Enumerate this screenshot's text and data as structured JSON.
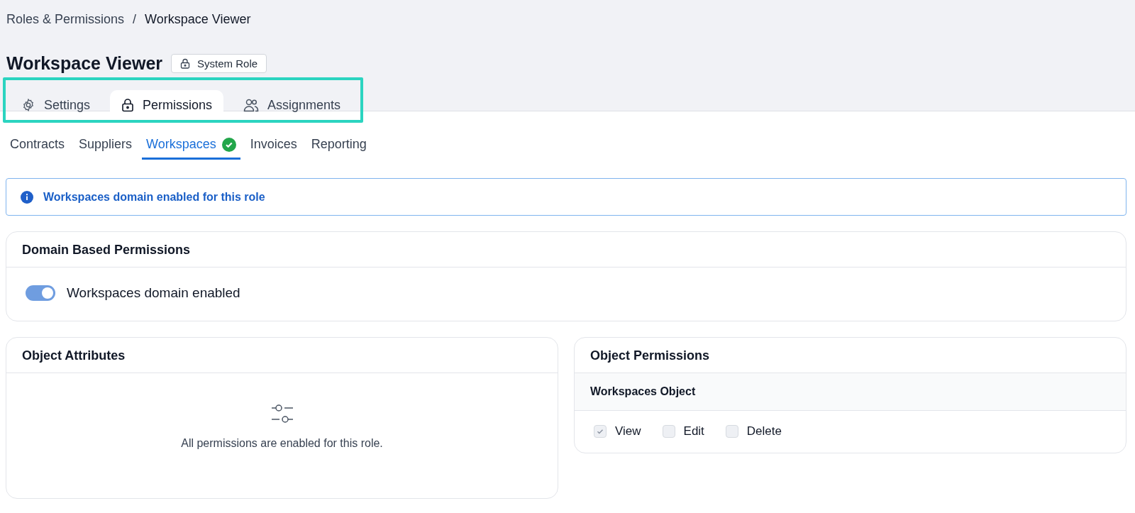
{
  "breadcrumb": [
    {
      "label": "Roles & Permissions",
      "current": false
    },
    {
      "label": "/",
      "current": false
    },
    {
      "label": "Workspace Viewer",
      "current": true
    }
  ],
  "page": {
    "title": "Workspace Viewer",
    "badge": "System Role"
  },
  "tabs": [
    {
      "label": "Settings",
      "kind": "settings",
      "selected": false
    },
    {
      "label": "Permissions",
      "kind": "permissions",
      "selected": true
    },
    {
      "label": "Assignments",
      "kind": "assignments",
      "selected": false
    }
  ],
  "domain_tabs": [
    {
      "label": "Contracts",
      "selected": false,
      "enabled": false
    },
    {
      "label": "Suppliers",
      "selected": false,
      "enabled": false
    },
    {
      "label": "Workspaces",
      "selected": true,
      "enabled": true
    },
    {
      "label": "Invoices",
      "selected": false,
      "enabled": false
    },
    {
      "label": "Reporting",
      "selected": false,
      "enabled": false
    }
  ],
  "banner": {
    "text": "Workspaces domain enabled for this role"
  },
  "domain_card": {
    "title": "Domain Based Permissions",
    "toggle": {
      "label": "Workspaces domain enabled",
      "on": true
    }
  },
  "attributes_card": {
    "title": "Object Attributes",
    "empty_text": "All permissions are enabled for this role."
  },
  "permissions_card": {
    "title": "Object Permissions",
    "object": "Workspaces Object",
    "options": [
      {
        "label": "View",
        "checked": true,
        "disabled": true
      },
      {
        "label": "Edit",
        "checked": false,
        "disabled": true
      },
      {
        "label": "Delete",
        "checked": false,
        "disabled": true
      }
    ]
  }
}
